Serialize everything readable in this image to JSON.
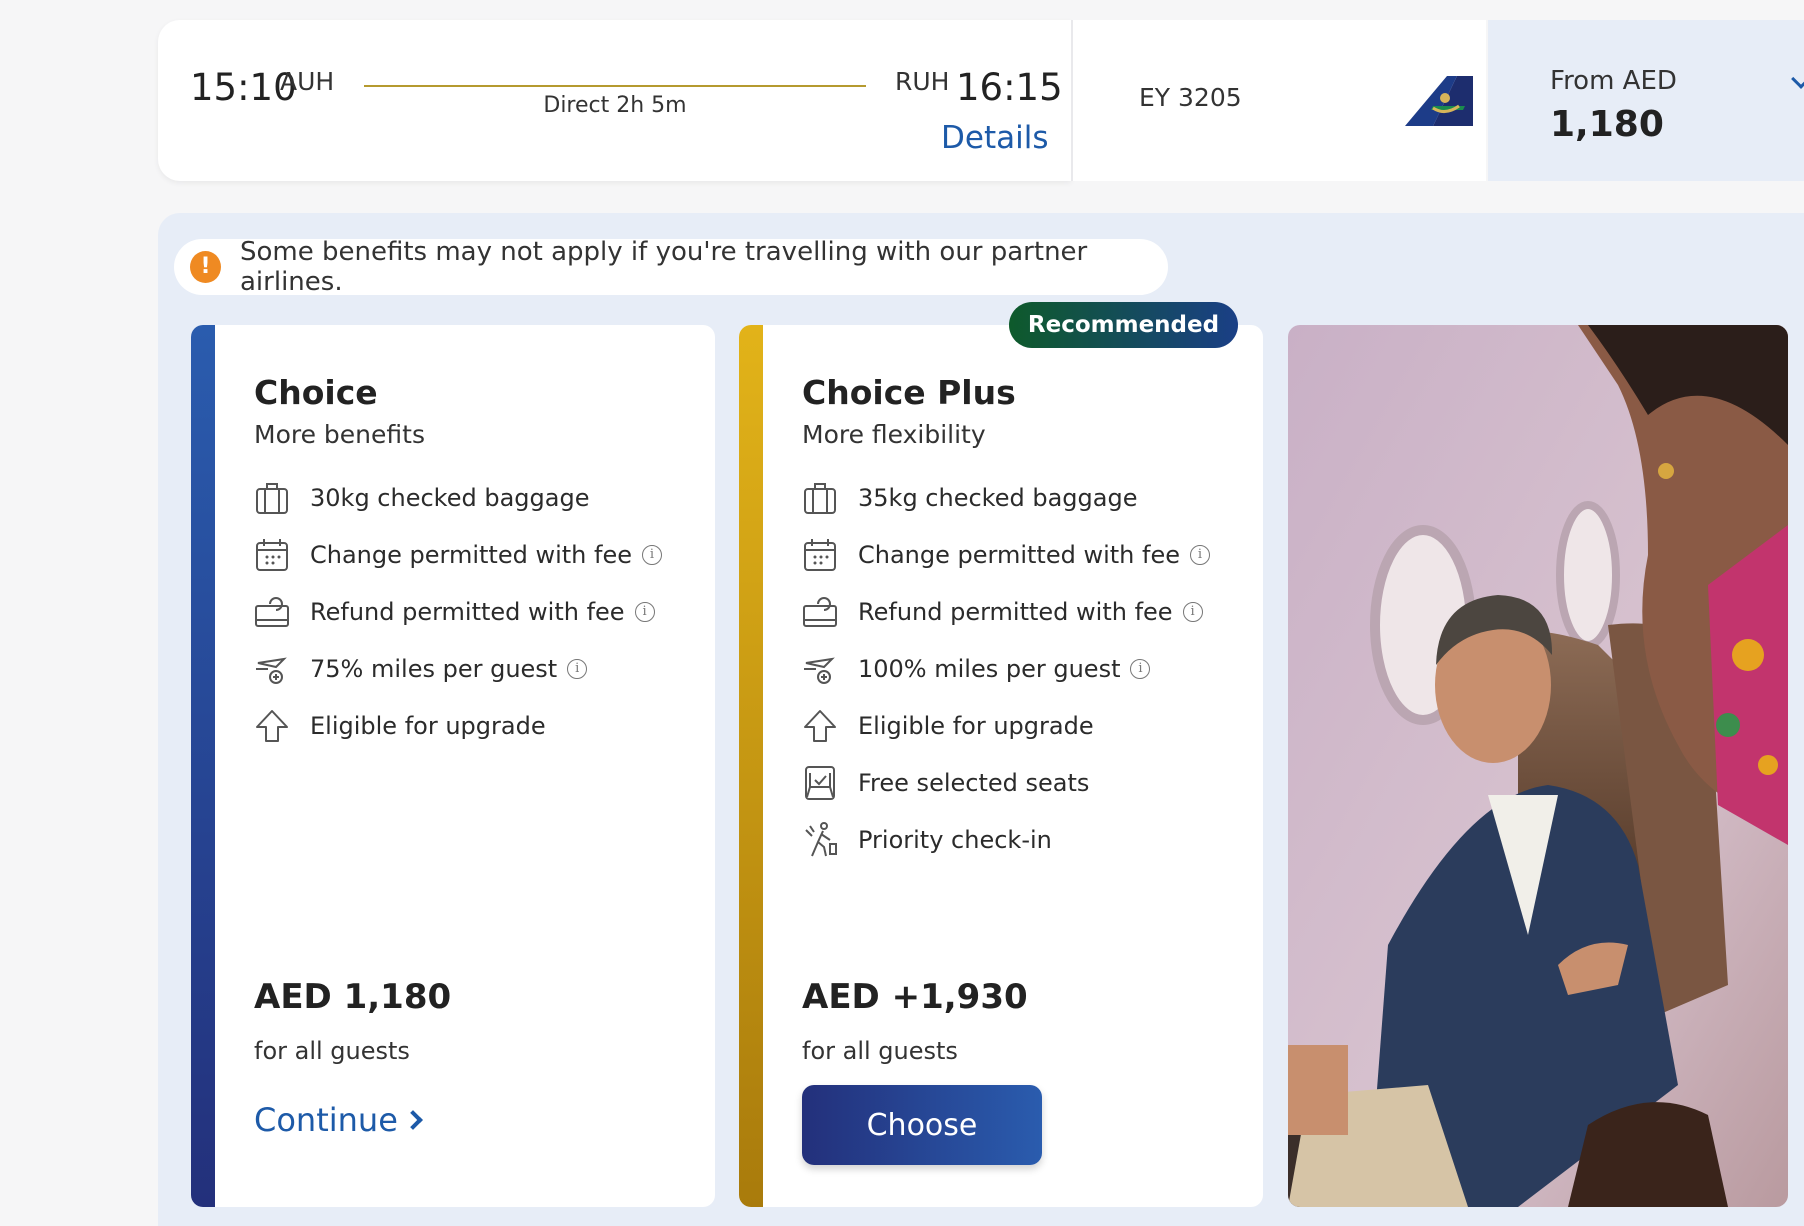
{
  "flight": {
    "departure_time": "15:10",
    "departure_code": "AUH",
    "route_info": "Direct 2h 5m",
    "arrival_code": "RUH",
    "arrival_time": "16:15",
    "details_label": "Details",
    "flight_number": "EY 3205",
    "airline_logo": "saudia-tail-logo",
    "price_label": "From AED",
    "price_value": "1,180"
  },
  "notice": {
    "icon": "warning-icon",
    "text": "Some benefits may not apply if you're travelling with our partner airlines."
  },
  "fares": [
    {
      "title": "Choice",
      "subtitle": "More benefits",
      "benefits": [
        {
          "icon": "baggage-icon",
          "text": "30kg checked baggage"
        },
        {
          "icon": "calendar-icon",
          "text": "Change permitted with fee"
        },
        {
          "icon": "refund-icon",
          "text": "Refund permitted with fee"
        },
        {
          "icon": "miles-plane-icon",
          "text": "75% miles per guest"
        },
        {
          "icon": "upgrade-arrow-icon",
          "text": "Eligible for upgrade"
        }
      ],
      "price": "AED 1,180",
      "price_note": "for all guests",
      "action_label": "Continue"
    },
    {
      "title": "Choice Plus",
      "subtitle": "More flexibility",
      "badge": "Recommended",
      "benefits": [
        {
          "icon": "baggage-icon",
          "text": "35kg checked baggage"
        },
        {
          "icon": "calendar-icon",
          "text": "Change permitted with fee"
        },
        {
          "icon": "refund-icon",
          "text": "Refund permitted with fee"
        },
        {
          "icon": "miles-plane-icon",
          "text": "100% miles per guest"
        },
        {
          "icon": "upgrade-arrow-icon",
          "text": "Eligible for upgrade"
        },
        {
          "icon": "seat-icon",
          "text": "Free selected seats"
        },
        {
          "icon": "priority-checkin-icon",
          "text": "Priority check-in"
        }
      ],
      "price": "AED +1,930",
      "price_note": "for all guests",
      "action_label": "Choose"
    }
  ],
  "colors": {
    "brand_blue": "#1d5aa8",
    "navy": "#23307b",
    "gold": "#e2b319",
    "panel_bg": "#e7edf7",
    "warning": "#ef8a22",
    "badge_green": "#0e5a2b"
  }
}
